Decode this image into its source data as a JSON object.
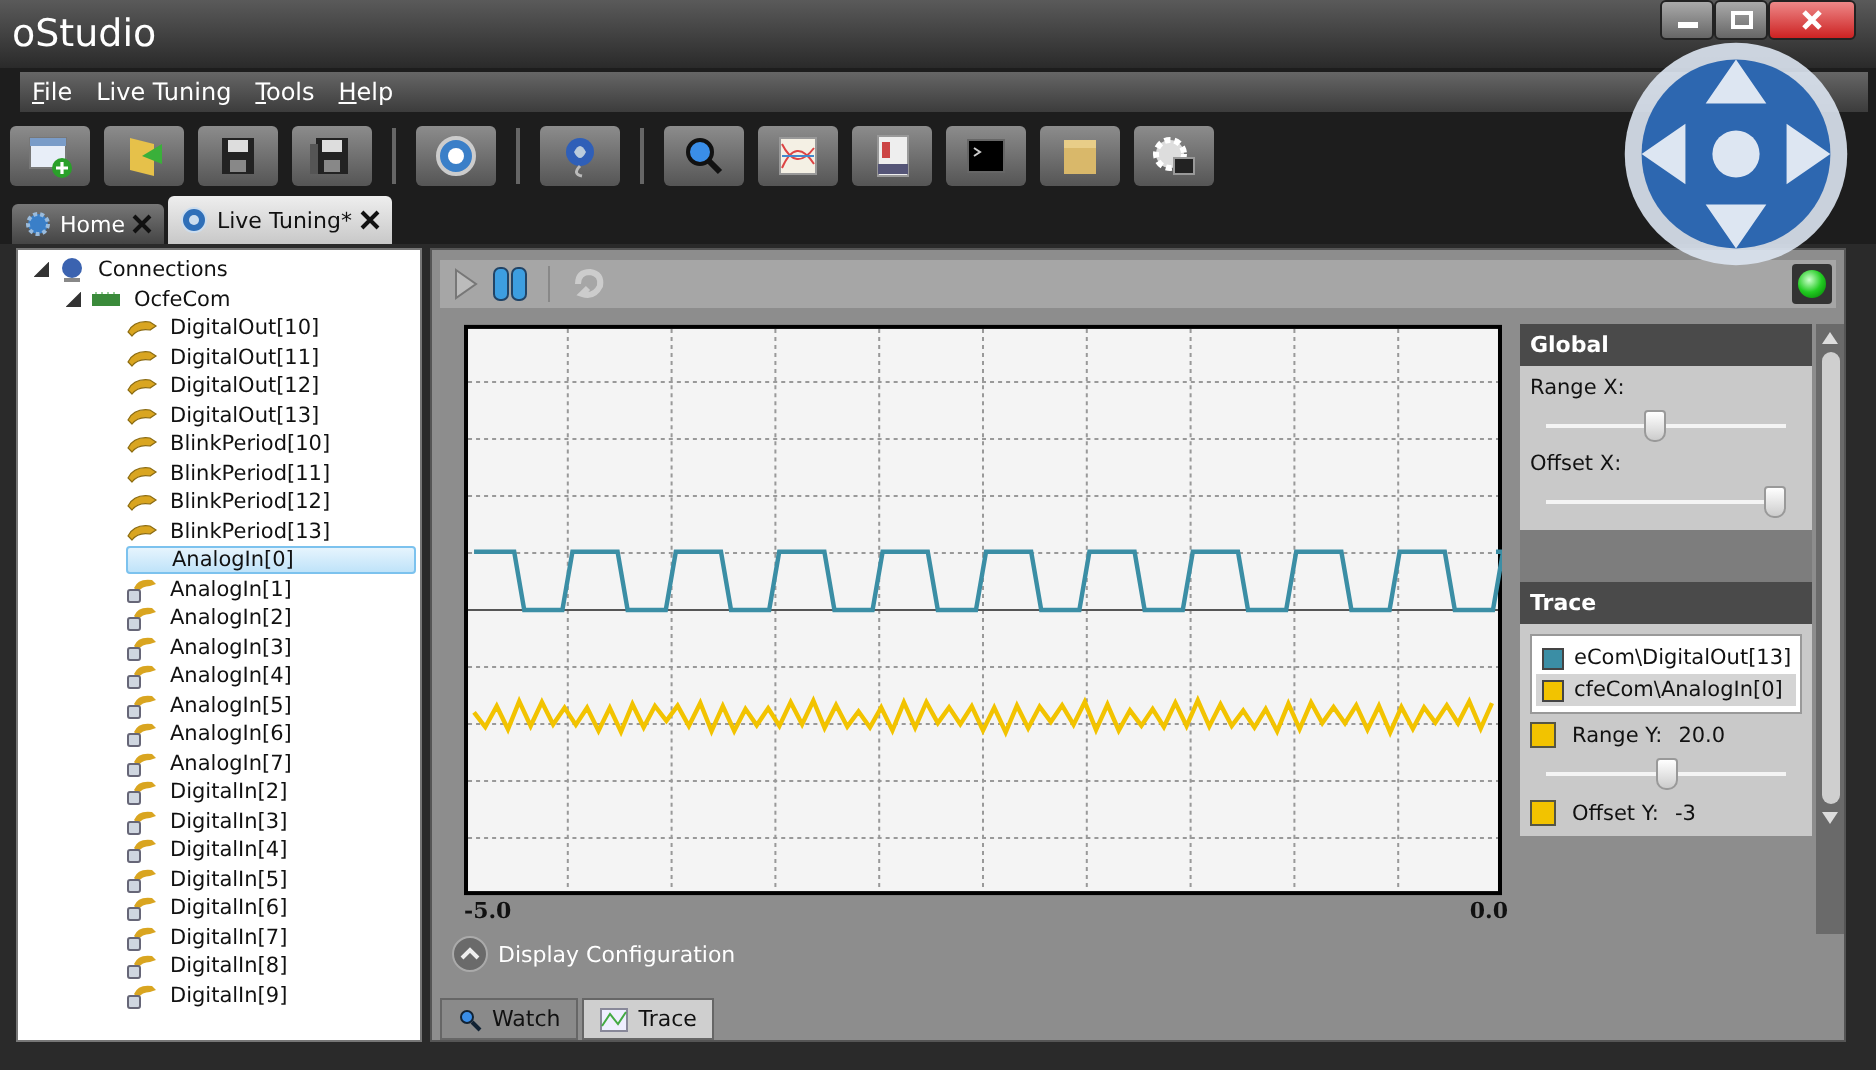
{
  "window": {
    "title": "oStudio"
  },
  "menu": [
    {
      "label": "File",
      "underlined": true
    },
    {
      "label": "Live Tuning",
      "underlined": false
    },
    {
      "label": "Tools",
      "underlined": true
    },
    {
      "label": "Help",
      "underlined": true
    }
  ],
  "toolbar": [
    {
      "items": [
        {
          "kind": "new"
        },
        {
          "kind": "open"
        },
        {
          "kind": "save"
        },
        {
          "kind": "save-all"
        }
      ]
    },
    {
      "items": [
        {
          "kind": "settings"
        }
      ]
    },
    {
      "items": [
        {
          "kind": "connect"
        }
      ]
    },
    {
      "items": [
        {
          "kind": "search"
        },
        {
          "kind": "chart"
        },
        {
          "kind": "log"
        },
        {
          "kind": "terminal"
        },
        {
          "kind": "package"
        },
        {
          "kind": "gear"
        }
      ]
    }
  ],
  "tabs": [
    {
      "label": "Home",
      "kind": "home",
      "selected": false
    },
    {
      "label": "Live Tuning*",
      "kind": "live",
      "selected": true
    }
  ],
  "tree": {
    "label": "Connections",
    "expanded": true,
    "children": [
      {
        "label": "OcfeCom",
        "expanded": true,
        "children": [
          {
            "label": "DigitalOut[10]",
            "kind": "output",
            "selected": false
          },
          {
            "label": "DigitalOut[11]",
            "kind": "output",
            "selected": false
          },
          {
            "label": "DigitalOut[12]",
            "kind": "output",
            "selected": false
          },
          {
            "label": "DigitalOut[13]",
            "kind": "output",
            "selected": false
          },
          {
            "label": "BlinkPeriod[10]",
            "kind": "output",
            "selected": false
          },
          {
            "label": "BlinkPeriod[11]",
            "kind": "output",
            "selected": false
          },
          {
            "label": "BlinkPeriod[12]",
            "kind": "output",
            "selected": false
          },
          {
            "label": "BlinkPeriod[13]",
            "kind": "output",
            "selected": false
          },
          {
            "label": "AnalogIn[0]",
            "kind": "input",
            "selected": true
          },
          {
            "label": "AnalogIn[1]",
            "kind": "input",
            "selected": false
          },
          {
            "label": "AnalogIn[2]",
            "kind": "input",
            "selected": false
          },
          {
            "label": "AnalogIn[3]",
            "kind": "input",
            "selected": false
          },
          {
            "label": "AnalogIn[4]",
            "kind": "input",
            "selected": false
          },
          {
            "label": "AnalogIn[5]",
            "kind": "input",
            "selected": false
          },
          {
            "label": "AnalogIn[6]",
            "kind": "input",
            "selected": false
          },
          {
            "label": "AnalogIn[7]",
            "kind": "input",
            "selected": false
          },
          {
            "label": "DigitalIn[2]",
            "kind": "input",
            "selected": false
          },
          {
            "label": "DigitalIn[3]",
            "kind": "input",
            "selected": false
          },
          {
            "label": "DigitalIn[4]",
            "kind": "input",
            "selected": false
          },
          {
            "label": "DigitalIn[5]",
            "kind": "input",
            "selected": false
          },
          {
            "label": "DigitalIn[6]",
            "kind": "input",
            "selected": false
          },
          {
            "label": "DigitalIn[7]",
            "kind": "input",
            "selected": false
          },
          {
            "label": "DigitalIn[8]",
            "kind": "input",
            "selected": false
          },
          {
            "label": "DigitalIn[9]",
            "kind": "input",
            "selected": false
          }
        ]
      }
    ]
  },
  "playback": [
    {
      "kind": "play",
      "disabled": true
    },
    {
      "kind": "pause",
      "disabled": false
    },
    {
      "kind": "reset",
      "disabled": true
    }
  ],
  "status_led": {
    "on": true
  },
  "plot": {
    "x_start": "-5.0",
    "x_end": "0.0"
  },
  "display_configuration": {
    "label": "Display Configuration"
  },
  "global": {
    "title": "Global",
    "sliders": [
      {
        "label": "Range X:",
        "level": 0.45
      },
      {
        "label": "Offset X:",
        "level": 1.0
      }
    ]
  },
  "trace": {
    "title": "Trace",
    "items": [
      {
        "label": "eCom\\DigitalOut[13]",
        "color": "#3b8ea5",
        "kind": "square",
        "selected": false
      },
      {
        "label": "cfeCom\\AnalogIn[0]",
        "color": "#f2c300",
        "kind": "noise",
        "selected": true
      }
    ],
    "range_y": {
      "label": "Range Y:",
      "value": "20.0",
      "level": 0.5
    },
    "offset_y": {
      "label": "Offset Y:",
      "value": "-3"
    }
  },
  "bottom_tabs": [
    {
      "label": "Watch",
      "kind": "watch",
      "selected": false
    },
    {
      "label": "Trace",
      "kind": "trace",
      "selected": true
    }
  ]
}
